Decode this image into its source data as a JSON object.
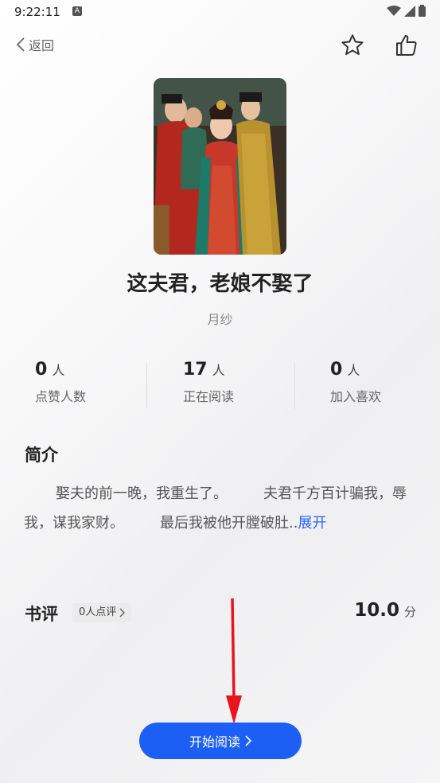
{
  "status": {
    "time": "9:22:11",
    "badge": "A"
  },
  "nav": {
    "back_label": "返回"
  },
  "book": {
    "title": "这夫君，老娘不娶了",
    "author": "月纱"
  },
  "stats": [
    {
      "value": "0",
      "unit": "人",
      "label": "点赞人数"
    },
    {
      "value": "17",
      "unit": "人",
      "label": "正在阅读"
    },
    {
      "value": "0",
      "unit": "人",
      "label": "加入喜欢"
    }
  ],
  "intro": {
    "heading": "简介",
    "text": "娶夫的前一晚，我重生了。　　　夫君千方百计骗我，辱我，谋我家财。　　　最后我被他开膛破肚..",
    "expand_label": "展开"
  },
  "reviews": {
    "heading": "书评",
    "count_label": "0人点评",
    "score": "10.0",
    "score_unit": "分"
  },
  "read_button": {
    "label": "开始阅读"
  },
  "colors": {
    "accent": "#1c5ff5",
    "link": "#2962ff",
    "annotation_arrow": "#e8141e"
  }
}
